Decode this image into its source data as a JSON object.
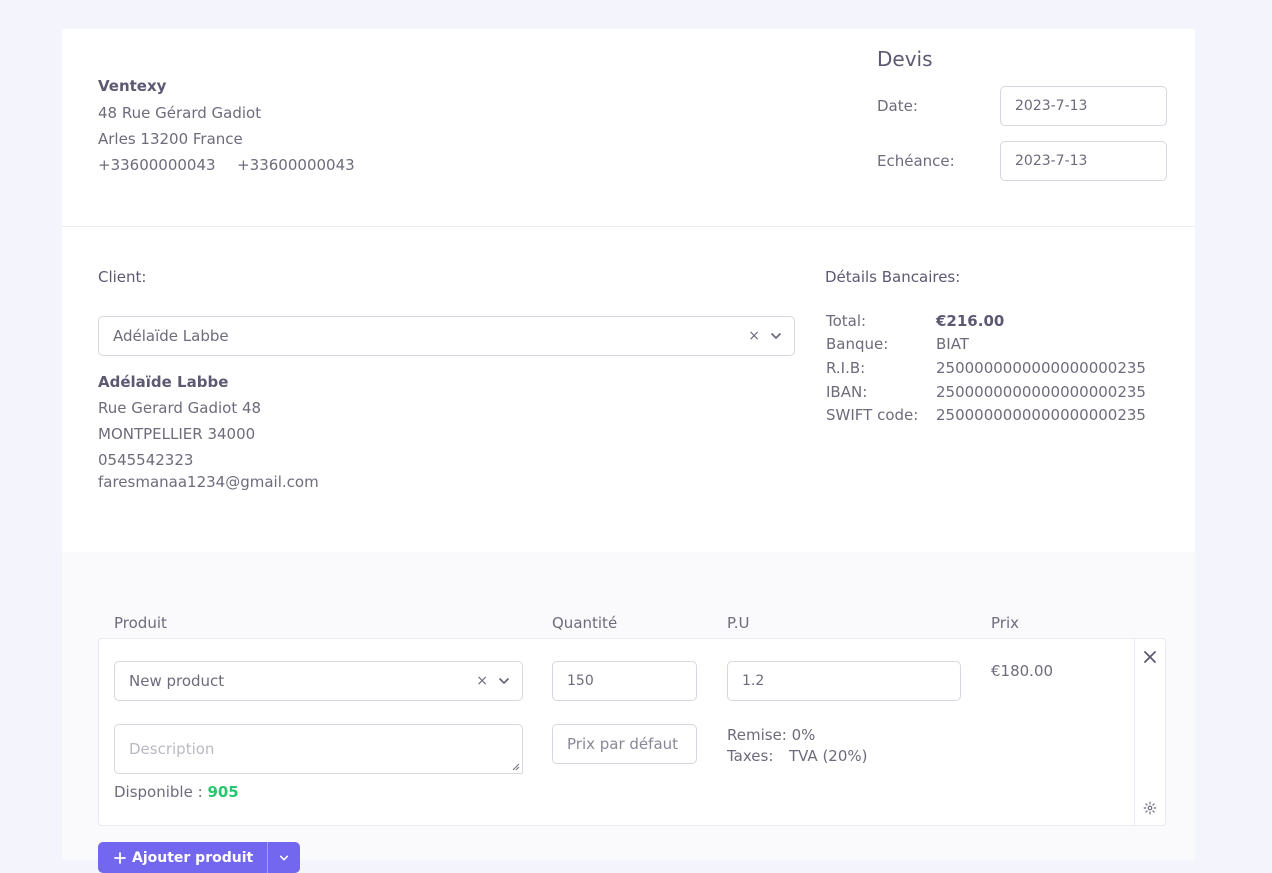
{
  "doc_type": "Devis",
  "company": {
    "name": "Ventexy",
    "address1": "48 Rue Gérard Gadiot",
    "address2": "Arles 13200 France",
    "phone1": "+33600000043",
    "phone2": "+33600000043"
  },
  "dates": {
    "date_label": "Date:",
    "date_value": "2023-7-13",
    "due_label": "Echéance:",
    "due_value": "2023-7-13"
  },
  "client": {
    "label": "Client:",
    "selected": "Adélaïde Labbe",
    "name": "Adélaïde Labbe",
    "address1": "Rue Gerard Gadiot 48",
    "address2": "MONTPELLIER 34000",
    "phone": "0545542323",
    "email": "faresmanaa1234@gmail.com"
  },
  "bank": {
    "title": "Détails Bancaires:",
    "total_label": "Total:",
    "total_value": "€216.00",
    "bank_label": "Banque:",
    "bank_value": "BIAT",
    "rib_label": "R.I.B:",
    "rib_value": "2500000000000000000235",
    "iban_label": "IBAN:",
    "iban_value": "2500000000000000000235",
    "swift_label": "SWIFT code:",
    "swift_value": "2500000000000000000235"
  },
  "items": {
    "headers": {
      "product": "Produit",
      "quantity": "Quantité",
      "unit_price": "P.U",
      "price": "Prix"
    },
    "row": {
      "product": "New product",
      "quantity": "150",
      "unit_price": "1.2",
      "price": "€180.00",
      "description_placeholder": "Description",
      "default_price_placeholder": "Prix par défaut",
      "discount": "Remise: 0%",
      "taxes_label": "Taxes:",
      "taxes_value": "TVA (20%)",
      "available_label": "Disponible :",
      "available_value": "905"
    },
    "add_button": "Ajouter produit"
  },
  "colors": {
    "accent": "#7367f0",
    "success": "#28c76f"
  },
  "icons": [
    "clear-icon",
    "chevron-down-icon",
    "close-icon",
    "gear-icon",
    "plus-icon"
  ]
}
